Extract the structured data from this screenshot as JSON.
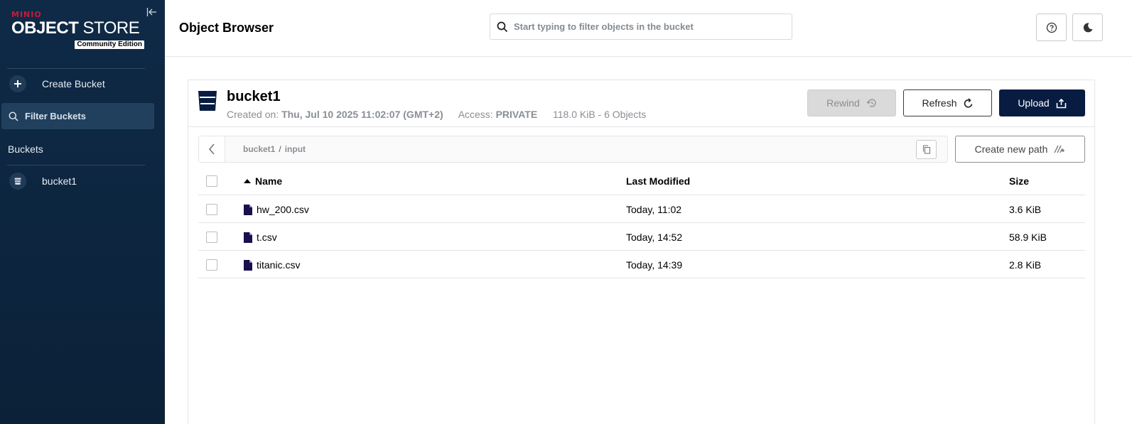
{
  "sidebar": {
    "logo": {
      "brand": "MINIO",
      "product_bold": "OBJECT",
      "product_rest": " STORE",
      "edition": "Community Edition"
    },
    "create_bucket_label": "Create Bucket",
    "filter_label": "Filter Buckets",
    "buckets_title": "Buckets",
    "buckets": [
      {
        "name": "bucket1"
      }
    ]
  },
  "header": {
    "title": "Object Browser",
    "search_placeholder": "Start typing to filter objects in the bucket"
  },
  "bucket": {
    "name": "bucket1",
    "created_label": "Created on:",
    "created_value": "Thu, Jul 10 2025 11:02:07 (GMT+2)",
    "access_label": "Access:",
    "access_value": "PRIVATE",
    "summary": "118.0 KiB - 6 Objects"
  },
  "actions": {
    "rewind": "Rewind",
    "refresh": "Refresh",
    "upload": "Upload",
    "create_path": "Create new path"
  },
  "path": {
    "crumbs": [
      "bucket1",
      "input"
    ],
    "separator": "/"
  },
  "table": {
    "columns": {
      "name": "Name",
      "modified": "Last Modified",
      "size": "Size"
    },
    "rows": [
      {
        "name": "hw_200.csv",
        "modified": "Today, 11:02",
        "size": "3.6 KiB"
      },
      {
        "name": "t.csv",
        "modified": "Today, 14:52",
        "size": "58.9 KiB"
      },
      {
        "name": "titanic.csv",
        "modified": "Today, 14:39",
        "size": "2.8 KiB"
      }
    ]
  },
  "colors": {
    "sidebar_bg": "#0f2a47",
    "brand_red": "#c51b3b",
    "upload_bg": "#081c42",
    "file_icon": "#1b0f4e"
  },
  "icons": [
    "collapse-icon",
    "plus-icon",
    "search-icon",
    "bucket-icon",
    "help-icon",
    "moon-icon",
    "rewind-icon",
    "refresh-icon",
    "upload-icon",
    "chevron-left-icon",
    "copy-icon",
    "new-path-icon",
    "sort-asc-icon",
    "file-icon"
  ]
}
